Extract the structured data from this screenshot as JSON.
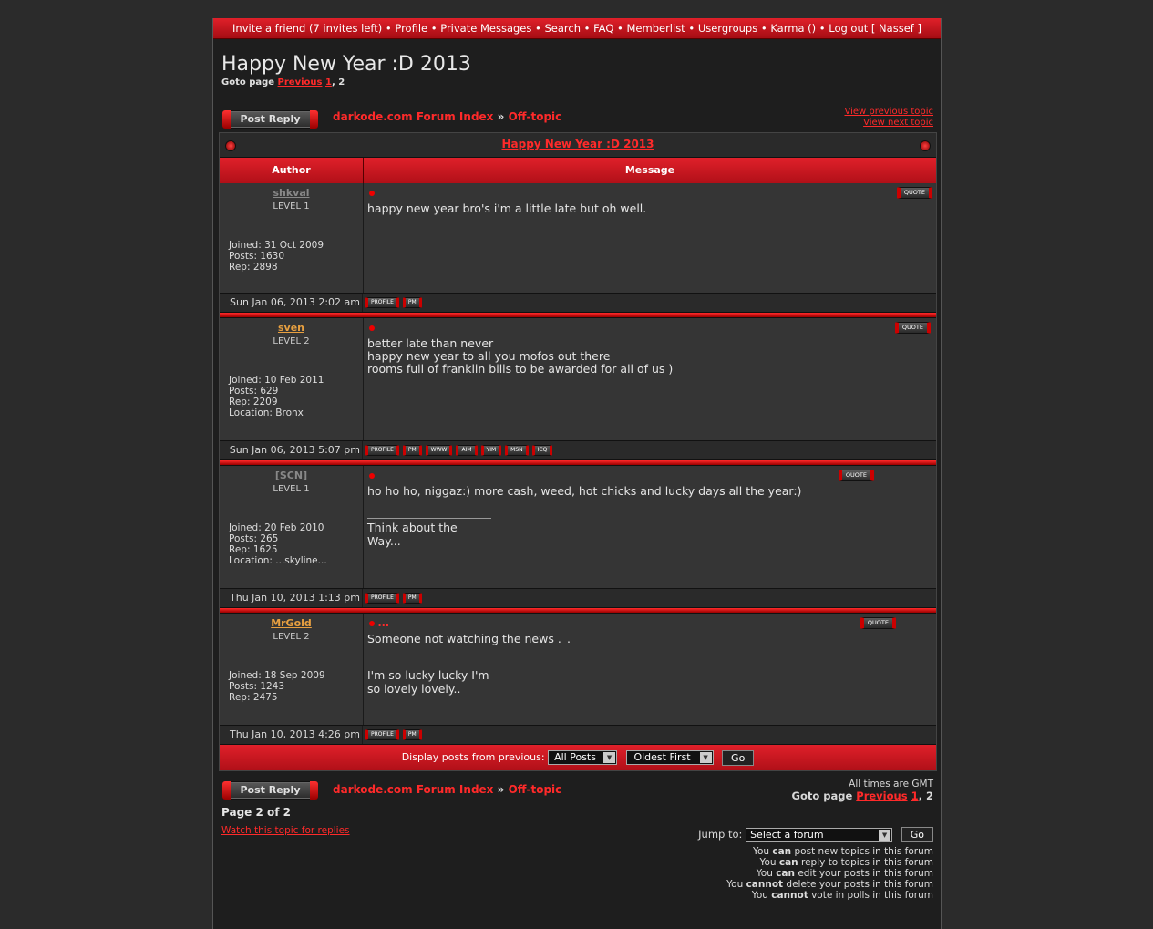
{
  "topnav": {
    "items": [
      "Invite a friend (7 invites left)",
      "Profile",
      "Private Messages",
      "Search",
      "FAQ",
      "Memberlist",
      "Usergroups",
      "Karma ()",
      "Log out [ Nassef ]"
    ]
  },
  "topic": {
    "title": "Happy New Year :D 2013",
    "goto_label": "Goto page",
    "previous": "Previous",
    "page1": "1",
    "page_sep": ",",
    "page2": "2"
  },
  "actions": {
    "post_reply": "Post Reply",
    "forum_index": "darkode.com Forum Index",
    "crumb_sep": "»",
    "forum": "Off-topic",
    "view_previous": "View previous topic",
    "view_next": "View next topic"
  },
  "table": {
    "caption": "Happy New Year :D 2013",
    "col_author": "Author",
    "col_message": "Message"
  },
  "posts": [
    {
      "username": "shkval",
      "level": "LEVEL 1",
      "joined": "Joined: 31 Oct 2009",
      "posts": "Posts: 1630",
      "rep": "Rep: 2898",
      "location": "",
      "subject": "",
      "lines": [
        "happy new year bro's i'm a little late but oh well."
      ],
      "signature": "",
      "date": "Sun Jan 06, 2013 2:02 am",
      "buttons": [
        "PROFILE",
        "PM"
      ]
    },
    {
      "username": "sven",
      "level": "LEVEL 2",
      "joined": "Joined: 10 Feb 2011",
      "posts": "Posts: 629",
      "rep": "Rep: 2209",
      "location": "Location: Bronx",
      "subject": "",
      "lines": [
        "better late than never",
        "happy new year to all you mofos out there",
        "rooms full of franklin bills to be awarded for all of us )"
      ],
      "signature": "",
      "date": "Sun Jan 06, 2013 5:07 pm",
      "buttons": [
        "PROFILE",
        "PM",
        "WWW",
        "AIM",
        "YIM",
        "MSN",
        "ICQ"
      ]
    },
    {
      "username": "[SCN]",
      "level": "LEVEL 1",
      "joined": "Joined: 20 Feb 2010",
      "posts": "Posts: 265",
      "rep": "Rep: 1625",
      "location": "Location: ...skyline...",
      "subject": "",
      "lines": [
        "ho ho ho, niggaz:) more cash, weed, hot chicks and lucky days all the year:)"
      ],
      "signature": "Think about the Way...",
      "date": "Thu Jan 10, 2013 1:13 pm",
      "buttons": [
        "PROFILE",
        "PM"
      ]
    },
    {
      "username": "MrGold",
      "level": "LEVEL 2",
      "joined": "Joined: 18 Sep 2009",
      "posts": "Posts: 1243",
      "rep": "Rep: 2475",
      "location": "",
      "subject": "...",
      "lines": [
        "Someone not watching the news ._."
      ],
      "signature": "I'm so lucky lucky I'm so lovely lovely..",
      "date": "Thu Jan 10, 2013 4:26 pm",
      "buttons": [
        "PROFILE",
        "PM"
      ]
    }
  ],
  "quote_label": "QUOTE",
  "display": {
    "label": "Display posts from previous:",
    "range": "All Posts",
    "order": "Oldest First",
    "go": "Go"
  },
  "footer": {
    "timezone": "All times are GMT",
    "page_of": "Page 2 of 2",
    "watch": "Watch this topic for replies",
    "jump_label": "Jump to:",
    "jump_select": "Select a forum",
    "jump_go": "Go",
    "permissions": [
      [
        "You ",
        "can",
        " post new topics in this forum"
      ],
      [
        "You ",
        "can",
        " reply to topics in this forum"
      ],
      [
        "You ",
        "can",
        " edit your posts in this forum"
      ],
      [
        "You ",
        "cannot",
        " delete your posts in this forum"
      ],
      [
        "You ",
        "cannot",
        " vote in polls in this forum"
      ]
    ]
  },
  "colors": {
    "accent": "#e0202a",
    "link": "#ff2a2a",
    "username_level1": "#888888",
    "username_level2": "#e8a040"
  }
}
